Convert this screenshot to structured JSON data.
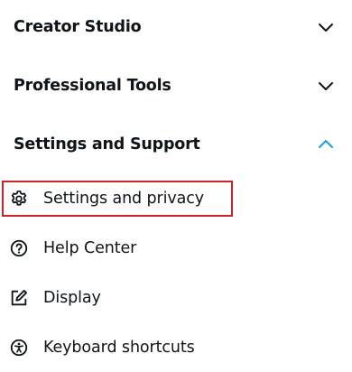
{
  "sections": [
    {
      "label": "Creator Studio",
      "state": "collapsed",
      "chevron_icon": "chevron-down-icon"
    },
    {
      "label": "Professional Tools",
      "state": "collapsed",
      "chevron_icon": "chevron-down-icon"
    },
    {
      "label": "Settings and Support",
      "state": "expanded",
      "chevron_icon": "chevron-up-icon"
    }
  ],
  "settings_support_items": [
    {
      "label": "Settings and privacy",
      "icon": "gear-icon",
      "highlighted": true
    },
    {
      "label": "Help Center",
      "icon": "question-circle-icon"
    },
    {
      "label": "Display",
      "icon": "edit-display-icon"
    },
    {
      "label": "Keyboard shortcuts",
      "icon": "accessibility-icon"
    }
  ],
  "colors": {
    "text": "#0f1419",
    "accent": "#1d9bf0",
    "highlight_border": "#d0202a"
  }
}
